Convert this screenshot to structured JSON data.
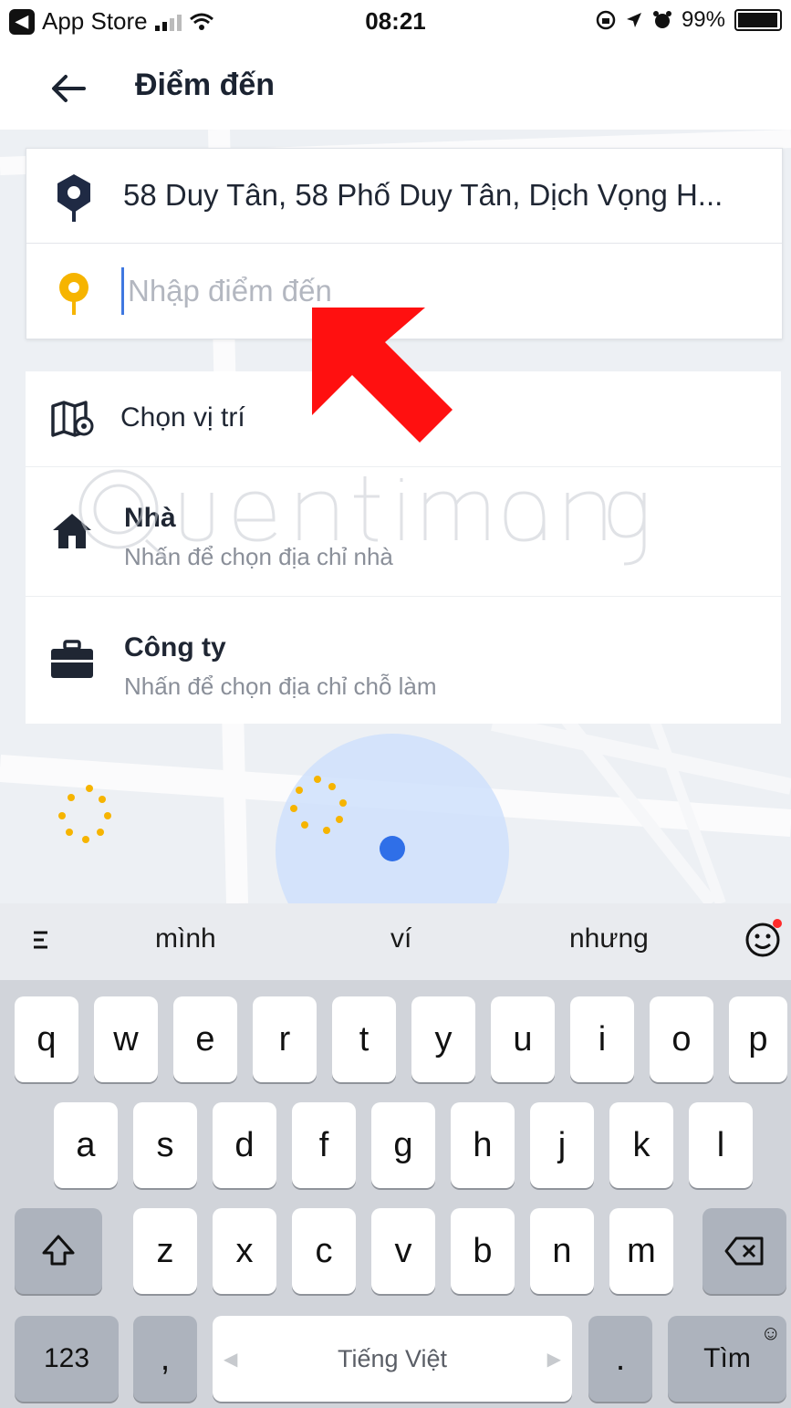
{
  "status_bar": {
    "back_app": "App Store",
    "time": "08:21",
    "battery": "99%"
  },
  "header": {
    "title": "Điểm đến"
  },
  "address": {
    "origin": "58 Duy Tân, 58 Phố Duy Tân, Dịch Vọng H...",
    "destination_placeholder": "Nhập điểm đến",
    "destination_value": ""
  },
  "options": {
    "choose_location": "Chọn vị trí",
    "home_title": "Nhà",
    "home_subtitle": "Nhấn để chọn địa chỉ nhà",
    "work_title": "Công ty",
    "work_subtitle": "Nhấn để chọn địa chỉ chỗ làm"
  },
  "keyboard": {
    "suggestions": [
      "mình",
      "ví",
      "nhưng"
    ],
    "row1": [
      "q",
      "w",
      "e",
      "r",
      "t",
      "y",
      "u",
      "i",
      "o",
      "p"
    ],
    "row2": [
      "a",
      "s",
      "d",
      "f",
      "g",
      "h",
      "j",
      "k",
      "l"
    ],
    "row3": [
      "z",
      "x",
      "c",
      "v",
      "b",
      "n",
      "m"
    ],
    "numbers_key": "123",
    "comma_key": ",",
    "space_label": "Tiếng Việt",
    "period_key": ".",
    "return_key": "Tìm"
  },
  "colors": {
    "origin_pin": "#1f2a44",
    "destination_pin": "#f6b400",
    "arrow": "#ff1010",
    "location_dot": "#2f6fe8"
  },
  "icons": {
    "back": "arrow-left-icon",
    "origin": "location-pin-icon",
    "destination": "destination-pin-icon",
    "map": "map-pin-icon",
    "home": "home-icon",
    "work": "briefcase-icon",
    "shift": "shift-icon",
    "backspace": "backspace-icon",
    "emoji": "emoji-icon"
  }
}
